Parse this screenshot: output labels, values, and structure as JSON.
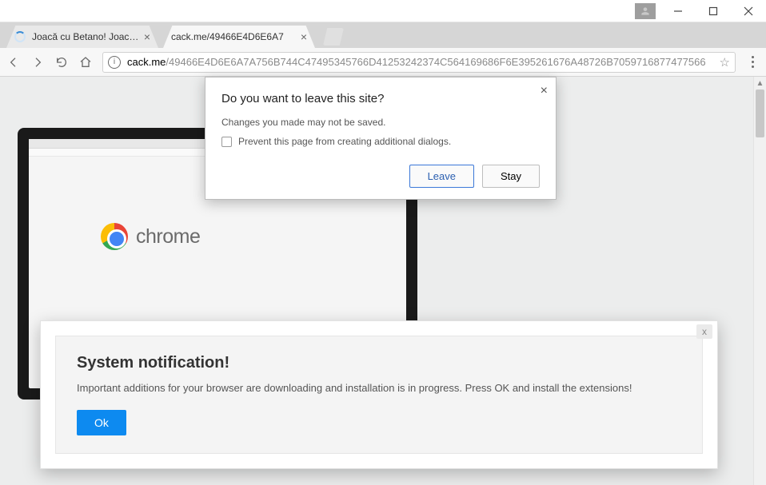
{
  "window": {
    "minimize_icon": "minimize",
    "maximize_icon": "maximize",
    "close_icon": "close"
  },
  "tabs": [
    {
      "label": "Joacă cu Betano! Joacă le",
      "active": false,
      "loading": true
    },
    {
      "label": "cack.me/49466E4D6E6A7",
      "active": true,
      "loading": false
    }
  ],
  "omnibox": {
    "host": "cack.me",
    "path": "/49466E4D6E6A7A756B744C47495345766D41253242374C564169686F6E395261676A48726B7059716877477566",
    "star": "☆"
  },
  "leave_dialog": {
    "title": "Do you want to leave this site?",
    "message": "Changes you made may not be saved.",
    "prevent_label": "Prevent this page from creating additional dialogs.",
    "leave_label": "Leave",
    "stay_label": "Stay"
  },
  "logo_text": "chrome",
  "notification": {
    "heading": "System notification!",
    "body": "Important additions for your browser are downloading and installation is in progress. Press OK and install the extensions!",
    "ok_label": "Ok",
    "close_label": "x"
  }
}
